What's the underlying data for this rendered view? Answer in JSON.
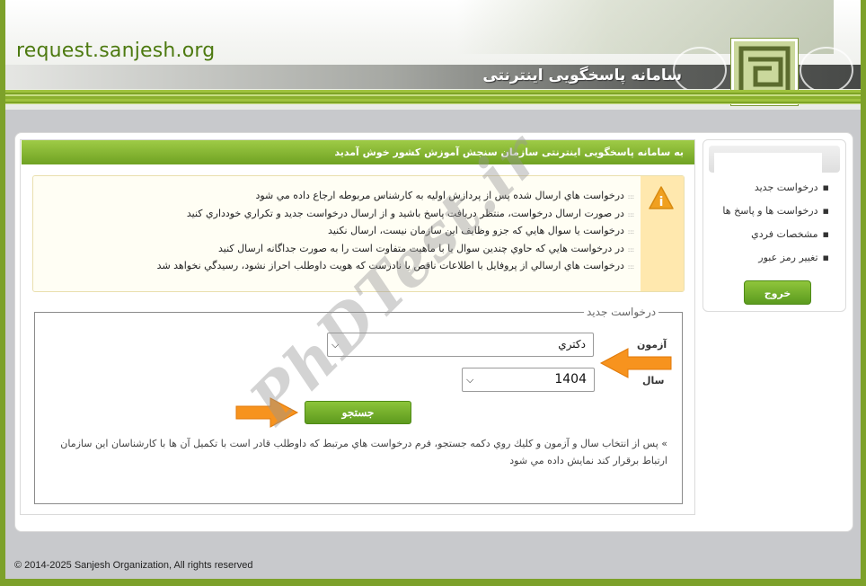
{
  "header": {
    "site_name": "request.sanjesh.org",
    "system_title": "سامانه پاسخگویی اینترنتی"
  },
  "welcome": {
    "text": "به سامانه پاسخگویی اینترنتی سازمان سنجش آموزش کشور خوش آمدید"
  },
  "notices": [
    "درخواست هاي ارسال شده پس از پردازش اوليه به كارشناس مربوطه ارجاع داده مي شود",
    "در صورت ارسال درخواست، منتظر دريافت پاسخ باشيد و از ارسال درخواست جديد و تكراري خودداري كنيد",
    "درخواست يا سوال هايي كه جزو وظايف اين سازمان نيست، ارسال نكنيد",
    "در درخواست هايي كه حاوي چندين سوال يا با ماهيت متفاوت است را به صورت جداگانه ارسال كنيد",
    "درخواست هاي ارسالي از پروفايل با اطلاعات ناقص يا نادرست كه هويت داوطلب احراز نشود، رسيدگي نخواهد شد"
  ],
  "form": {
    "legend": "درخواست جديد",
    "exam_label": "آزمون",
    "exam_value": "دكتري",
    "year_label": "سال",
    "year_value": "1404",
    "search_label": "جستجو",
    "hint": "» پس از انتخاب سال و آزمون و كليك روي دكمه جستجو، فرم درخواست هاي مرتبط كه داوطلب قادر است با تكميل آن ها با كارشناسان اين سازمان ارتباط برقرار كند نمايش داده مي شود"
  },
  "sidebar": {
    "items": [
      {
        "label": "درخواست جدید"
      },
      {
        "label": "درخواست ها و پاسخ ها"
      },
      {
        "label": "مشخصات فردي"
      },
      {
        "label": "تغيير رمز عبور"
      }
    ],
    "logout_label": "خروج"
  },
  "watermark": "PhDTest.ir",
  "footer": {
    "copyright": "© 2014-2025 Sanjesh Organization, All rights reserved"
  },
  "colors": {
    "brand_green": "#7da12a",
    "button_green": "#6fa223",
    "notice_bg": "#fffef4",
    "notice_icon_bg": "#ffe8ae",
    "arrow_orange": "#f7931e"
  }
}
